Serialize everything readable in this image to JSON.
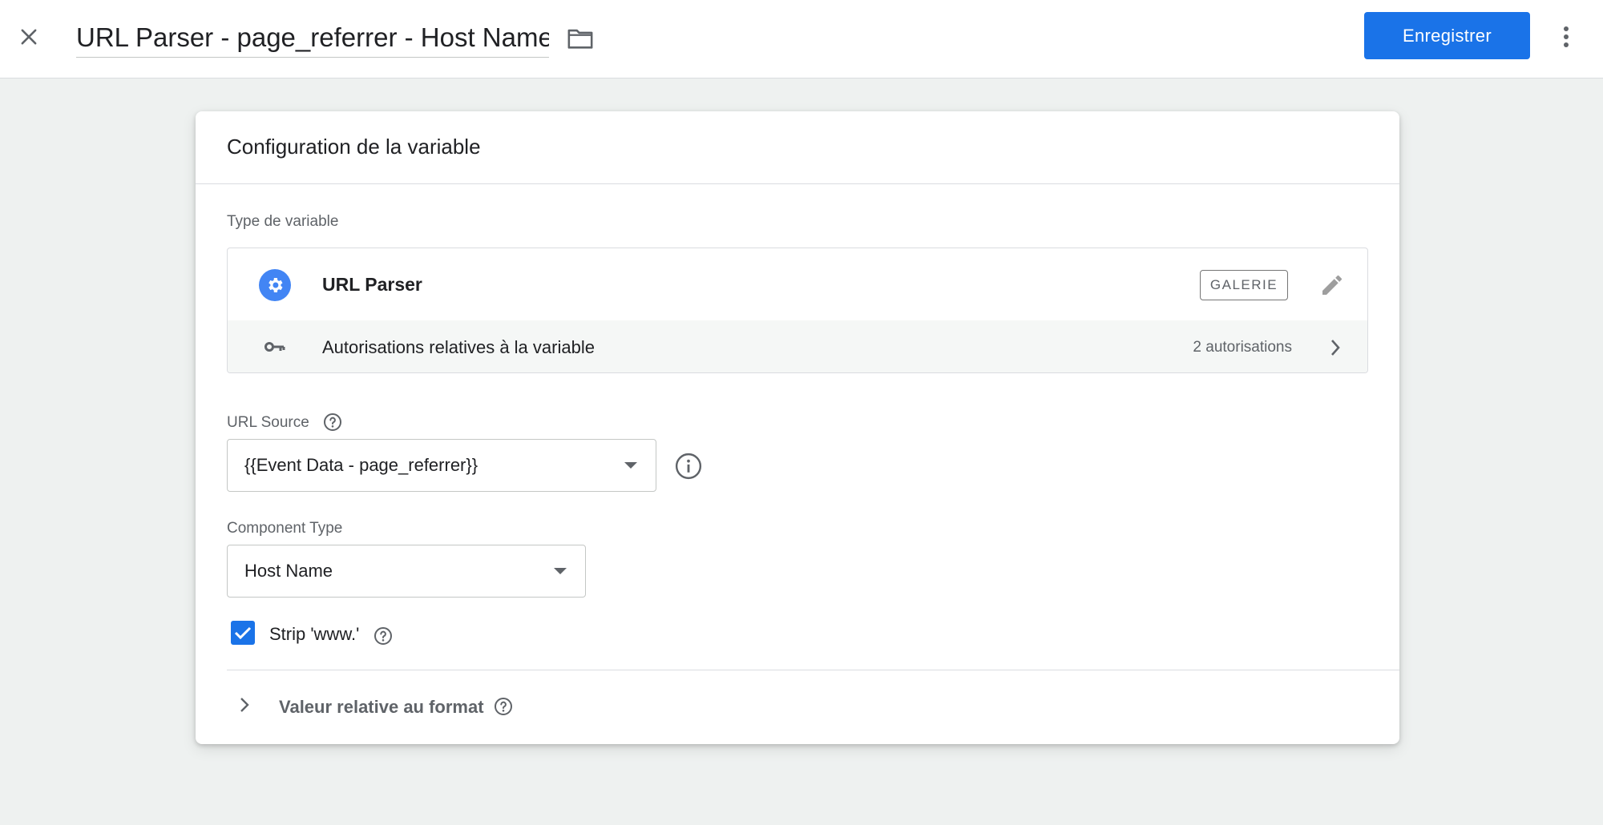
{
  "header": {
    "close_icon": "close-icon",
    "title_value": "URL Parser - page_referrer - Host Name",
    "folder_icon": "folder-icon",
    "save_label": "Enregistrer",
    "more_icon": "more-vert-icon"
  },
  "card": {
    "title": "Configuration de la variable",
    "variable_type": {
      "label": "Type de variable",
      "icon": "gear-icon",
      "name": "URL Parser",
      "badge": "GALERIE",
      "edit_icon": "pencil-icon",
      "permissions": {
        "icon": "key-icon",
        "label": "Autorisations relatives à la variable",
        "count": "2 autorisations",
        "chevron_icon": "chevron-right-icon"
      }
    },
    "url_source": {
      "label": "URL Source",
      "value": "{{Event Data - page_referrer}}",
      "help_icon": "help-icon",
      "info_icon": "info-icon"
    },
    "component_type": {
      "label": "Component Type",
      "value": "Host Name"
    },
    "strip_www": {
      "label": "Strip 'www.'",
      "checked": true
    },
    "format_value": {
      "label": "Valeur relative au format",
      "chevron_icon": "chevron-right-icon"
    }
  },
  "colors": {
    "accent": "#1a73e8",
    "icon_blue": "#4285f4",
    "background": "#eef1f0"
  }
}
